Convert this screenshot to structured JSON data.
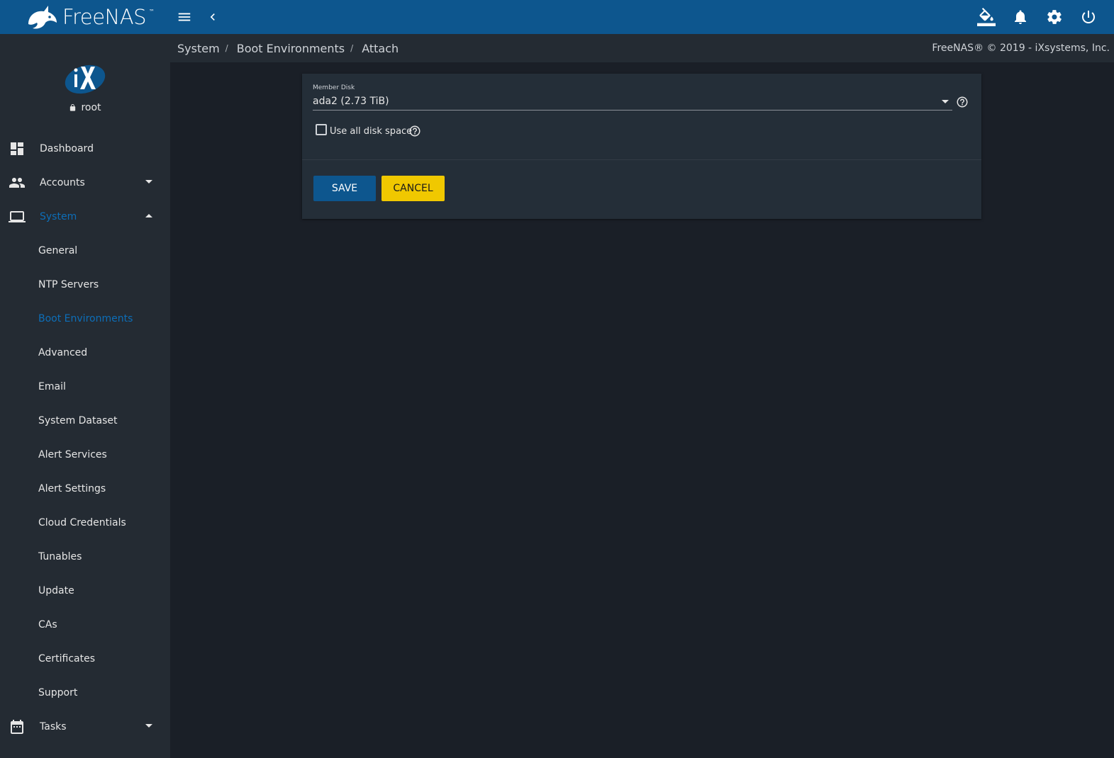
{
  "app": {
    "brand": "FreeNAS",
    "brand_tm": "™",
    "accent_color": "#0d568e",
    "active_color": "#0d6eb8",
    "warning_color": "#f0c800"
  },
  "topbar": {
    "menu_icon": "hamburger-menu-icon",
    "back_icon": "chevron-left-icon",
    "right_icons": [
      "paint-bucket-icon",
      "bell-icon",
      "gear-icon",
      "power-icon"
    ]
  },
  "sidebar": {
    "user": "root",
    "items": [
      {
        "label": "Dashboard",
        "icon": "dashboard-icon"
      },
      {
        "label": "Accounts",
        "icon": "people-icon"
      },
      {
        "label": "System",
        "icon": "laptop-icon"
      }
    ],
    "system_children": [
      "General",
      "NTP Servers",
      "Boot Environments",
      "Advanced",
      "Email",
      "System Dataset",
      "Alert Services",
      "Alert Settings",
      "Cloud Credentials",
      "Tunables",
      "Update",
      "CAs",
      "Certificates",
      "Support"
    ],
    "tasks": {
      "label": "Tasks",
      "icon": "calendar-icon"
    }
  },
  "breadcrumb": {
    "items": [
      "System",
      "Boot Environments",
      "Attach"
    ],
    "separator": "/",
    "copyright": "FreeNAS® © 2019 - iXsystems, Inc."
  },
  "form": {
    "member_disk_label": "Member Disk",
    "member_disk_value": "ada2 (2.73 TiB)",
    "use_all_label": "Use all disk space",
    "use_all_checked": false,
    "save_label": "SAVE",
    "cancel_label": "CANCEL"
  }
}
